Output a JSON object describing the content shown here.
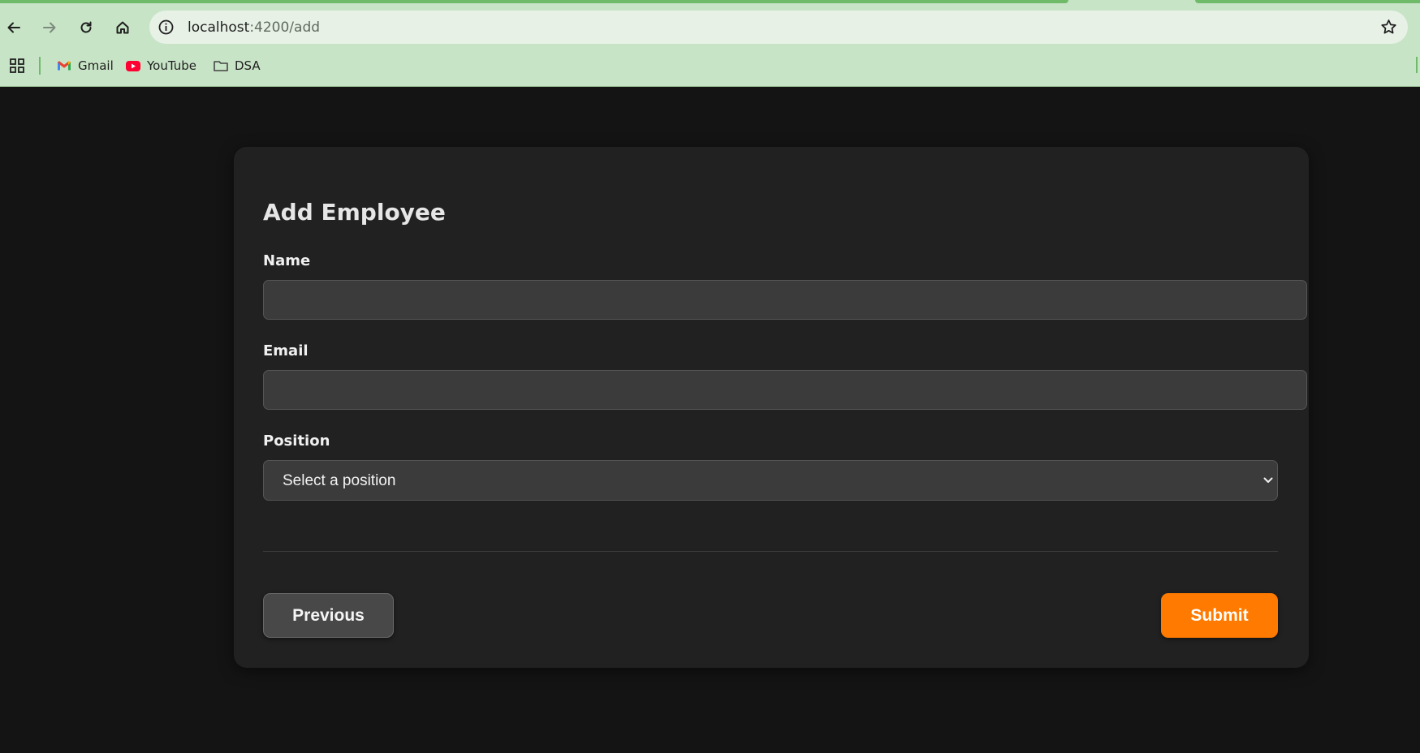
{
  "browser": {
    "url_host": "localhost",
    "url_path": ":4200/add",
    "bookmarks": [
      {
        "label": "Gmail",
        "icon": "gmail-icon"
      },
      {
        "label": "YouTube",
        "icon": "youtube-icon"
      },
      {
        "label": "DSA",
        "icon": "folder-icon"
      }
    ]
  },
  "form": {
    "title": "Add Employee",
    "name_label": "Name",
    "name_value": "",
    "email_label": "Email",
    "email_value": "",
    "position_label": "Position",
    "position_selected": "Select a position",
    "previous_label": "Previous",
    "submit_label": "Submit"
  },
  "colors": {
    "page_background": "#141414",
    "card_background": "#212121",
    "input_background": "#3b3b3b",
    "submit_accent": "#ff7a00",
    "browser_chrome": "#c8e4c6"
  }
}
